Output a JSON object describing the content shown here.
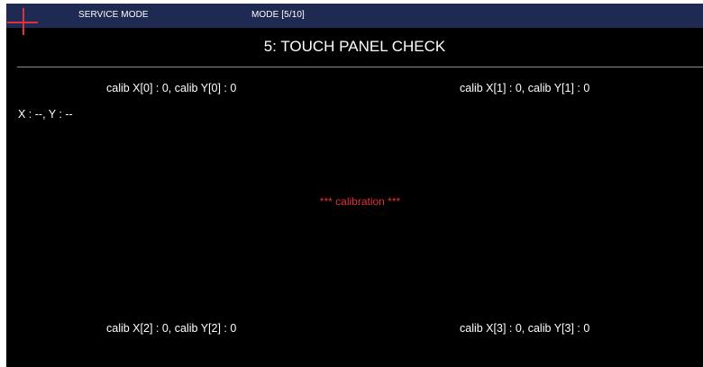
{
  "header": {
    "service_mode": "SERVICE MODE",
    "mode": "MODE [5/10]",
    "cursor_icon": "crosshair-icon"
  },
  "title": "5: TOUCH PANEL CHECK",
  "calibration": {
    "points": [
      "calib X[0] : 0, calib Y[0] : 0",
      "calib X[1] : 0, calib Y[1] : 0",
      "calib X[2] : 0, calib Y[2] : 0",
      "calib X[3] : 0, calib Y[3] : 0"
    ],
    "status": "*** calibration ***"
  },
  "coordinates": "X : --, Y : --",
  "colors": {
    "background": "#000000",
    "header_bar": "#1e2a52",
    "text": "#ffffff",
    "accent_red": "#e0303a",
    "divider": "#8a8a8a"
  }
}
